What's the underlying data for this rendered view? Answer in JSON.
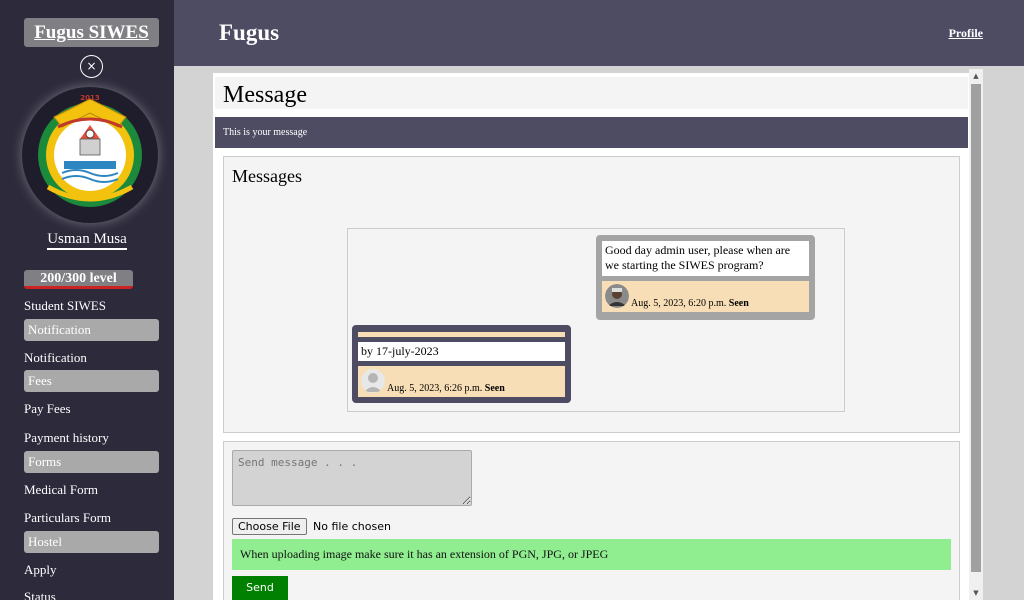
{
  "sidebar": {
    "brand": "Fugus SIWES",
    "close_symbol": "×",
    "logo_icon": "university-seal-icon",
    "user_name": "Usman Musa",
    "level": "200/300 level",
    "items": [
      {
        "label": "Student SIWES",
        "style": "plain"
      },
      {
        "label": "Notification",
        "style": "box"
      },
      {
        "label": "Notification",
        "style": "plain"
      },
      {
        "label": "Fees",
        "style": "box"
      },
      {
        "label": "Pay Fees",
        "style": "plain"
      },
      {
        "label": "Payment history",
        "style": "plain"
      },
      {
        "label": "Forms",
        "style": "box"
      },
      {
        "label": "Medical Form",
        "style": "plain"
      },
      {
        "label": "Particulars Form",
        "style": "plain"
      },
      {
        "label": "Hostel",
        "style": "box"
      },
      {
        "label": "Apply",
        "style": "plain"
      },
      {
        "label": "Status",
        "style": "plain"
      }
    ]
  },
  "header": {
    "title": "Fugus",
    "profile_link": "Profile"
  },
  "page": {
    "title": "Message",
    "banner": "This is your message"
  },
  "messages": {
    "title": "Messages",
    "incoming": {
      "text": "Good day admin user, please when are we starting the SIWES program?",
      "timestamp": "Aug. 5, 2023, 6:20 p.m.",
      "status": "Seen",
      "avatar_icon": "user-photo-icon"
    },
    "outgoing": {
      "text": "by 17-july-2023",
      "timestamp": "Aug. 5, 2023, 6:26 p.m.",
      "status": "Seen",
      "avatar_icon": "default-avatar-icon"
    }
  },
  "composer": {
    "placeholder": "Send message . . .",
    "choose_file_label": "Choose File",
    "no_file_text": "No file chosen",
    "hint": "When uploading image make sure it has an extension of PGN, JPG, or JPEG",
    "send_label": "Send"
  },
  "colors": {
    "sidebar_bg": "#2c2a3b",
    "header_bg": "#4e4c63",
    "hint_bg": "#90ee90",
    "send_bg": "#008000",
    "meta_bg": "#f7deb6"
  }
}
